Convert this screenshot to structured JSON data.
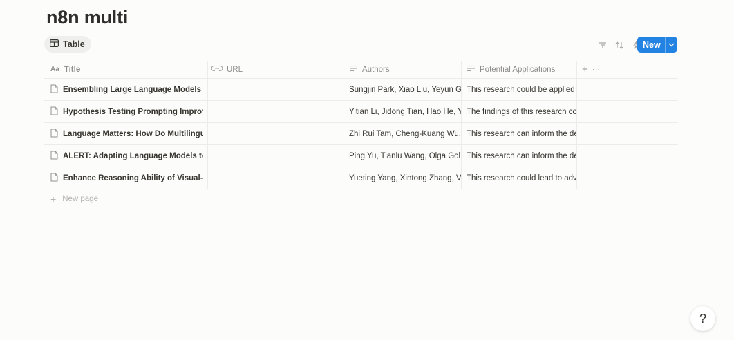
{
  "page": {
    "title": "n8n multi"
  },
  "view": {
    "tab_label": "Table"
  },
  "toolbar": {
    "icons": [
      "filter-icon",
      "sort-icon",
      "automation-icon",
      "search-icon",
      "settings-icon"
    ],
    "new_label": "New"
  },
  "columns": {
    "title": {
      "icon": "Aa",
      "label": "Title"
    },
    "url": {
      "label": "URL"
    },
    "authors": {
      "label": "Authors"
    },
    "apps": {
      "label": "Potential Applications"
    },
    "add": "+",
    "more": "···"
  },
  "rows": [
    {
      "title": "Ensembling Large Language Models wi",
      "url": "",
      "authors": "Sungjin Park, Xiao Liu, Yeyun Go",
      "apps": "This research could be applied"
    },
    {
      "title": "Hypothesis Testing Prompting Improve",
      "url": "",
      "authors": "Yitian Li, Jidong Tian, Hao He, Y",
      "apps": "The findings of this research co"
    },
    {
      "title": "Language Matters: How Do Multilingua",
      "url": "",
      "authors": "Zhi Rui Tam, Cheng-Kuang Wu,",
      "apps": "This research can inform the de"
    },
    {
      "title": "ALERT: Adapting Language Models to F",
      "url": "",
      "authors": "Ping Yu, Tianlu Wang, Olga Gol",
      "apps": "This research can inform the de"
    },
    {
      "title": "Enhance Reasoning Ability of Visual-La",
      "url": "",
      "authors": "Yueting Yang, Xintong Zhang, V",
      "apps": "This research could lead to adv"
    }
  ],
  "footer": {
    "new_page_plus": "+",
    "new_page_label": "New page"
  },
  "help": {
    "glyph": "?"
  },
  "colors": {
    "accent": "#2383e2",
    "text": "#37352f",
    "muted": "#8e8d89"
  }
}
